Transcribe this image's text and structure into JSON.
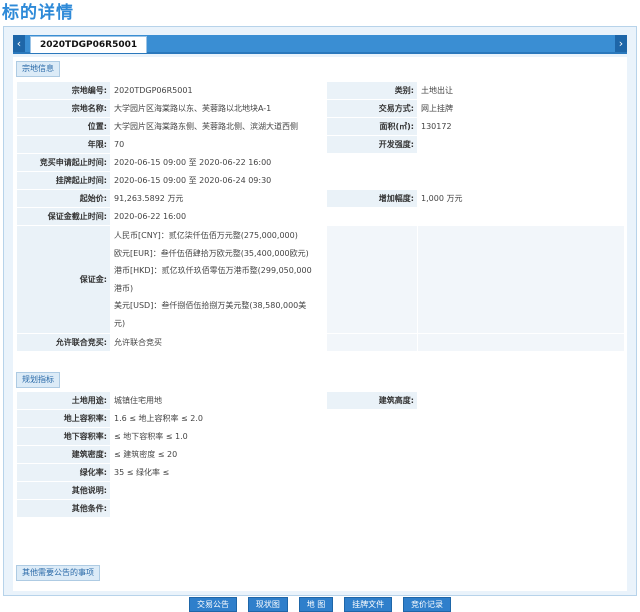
{
  "page": {
    "title": "标的详情"
  },
  "tabs": {
    "active": "2020TDGP06R5001"
  },
  "sections": {
    "parcel": "宗地信息",
    "planning": "规划指标",
    "other": "其他需要公告的事项"
  },
  "parcel": {
    "rows": [
      {
        "k1": "宗地编号:",
        "v1": "2020TDGP06R5001",
        "k2": "类别:",
        "v2": "土地出让"
      },
      {
        "k1": "宗地名称:",
        "v1": "大学园片区海棠路以东、芙蓉路以北地块A-1",
        "k2": "交易方式:",
        "v2": "网上挂牌"
      },
      {
        "k1": "位置:",
        "v1": "大学园片区海棠路东侧、芙蓉路北侧、滨湖大道西侧",
        "k2": "面积(㎡):",
        "v2": "130172"
      },
      {
        "k1": "年限:",
        "v1": "70",
        "k2": "开发强度:",
        "v2": ""
      }
    ],
    "apply_time": {
      "label": "竞买申请起止时间:",
      "value": "2020-06-15 09:00 至 2020-06-22 16:00"
    },
    "listing_time": {
      "label": "挂牌起止时间:",
      "value": "2020-06-15 09:00 至 2020-06-24 09:30"
    },
    "start_price": {
      "label": "起始价:",
      "value": "91,263.5892 万元",
      "inc_label": "增加幅度:",
      "inc_value": "1,000 万元"
    },
    "deposit_deadline": {
      "label": "保证金截止时间:",
      "value": "2020-06-22 16:00"
    },
    "deposit": {
      "label": "保证金:",
      "lines": [
        "人民币[CNY]：贰亿柒仟伍佰万元整(275,000,000)",
        "欧元[EUR]：叁仟伍佰肆拾万欧元整(35,400,000欧元)",
        "港币[HKD]：贰亿玖仟玖佰零伍万港币整(299,050,000",
        "港币)",
        "美元[USD]：叁仟捌佰伍拾捌万美元整(38,580,000美",
        "元)"
      ]
    },
    "joint": {
      "label": "允许联合竞买:",
      "value": "允许联合竞买"
    }
  },
  "planning": {
    "use": {
      "label": "土地用途:",
      "value": "城镇住宅用地",
      "k2": "建筑高度:",
      "v2": ""
    },
    "rows": [
      {
        "label": "地上容积率:",
        "value": "1.6 ≤ 地上容积率 ≤ 2.0"
      },
      {
        "label": "地下容积率:",
        "value": "≤ 地下容积率 ≤ 1.0"
      },
      {
        "label": "建筑密度:",
        "value": "≤ 建筑密度 ≤ 20"
      },
      {
        "label": "绿化率:",
        "value": "35 ≤ 绿化率 ≤"
      },
      {
        "label": "其他说明:",
        "value": ""
      },
      {
        "label": "其他条件:",
        "value": ""
      }
    ]
  },
  "buttons": [
    "交易公告",
    "现状图",
    "地 图",
    "挂牌文件",
    "竞价记录"
  ]
}
